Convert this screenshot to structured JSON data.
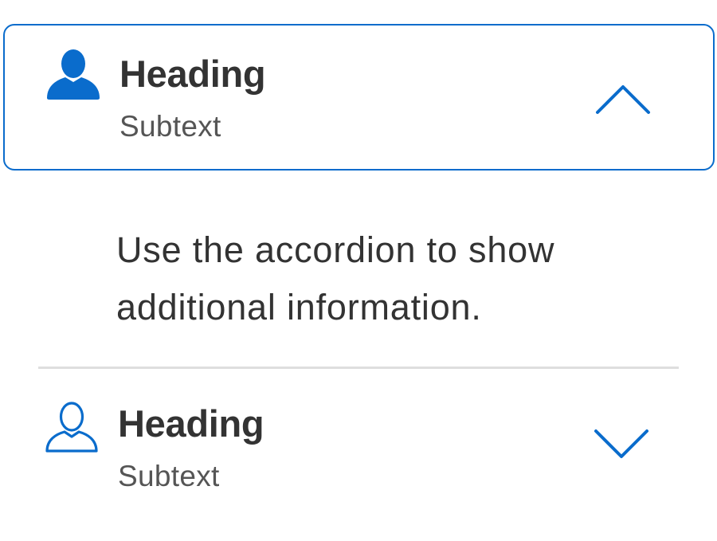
{
  "accordion": {
    "items": [
      {
        "heading": "Heading",
        "subtext": "Subtext",
        "icon": "person-filled-icon",
        "chevron": "chevron-up-icon",
        "expanded": true,
        "content": "Use the accordion to show additional information."
      },
      {
        "heading": "Heading",
        "subtext": "Subtext",
        "icon": "person-outline-icon",
        "chevron": "chevron-down-icon",
        "expanded": false
      }
    ]
  },
  "colors": {
    "accent": "#0a6ccc",
    "text": "#333333",
    "subtext": "#555555",
    "divider": "#dedede"
  }
}
